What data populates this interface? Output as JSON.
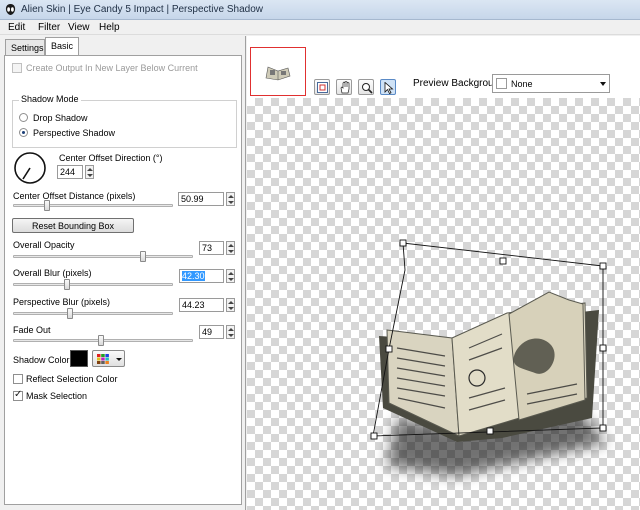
{
  "window": {
    "title": "Alien Skin | Eye Candy 5 Impact | Perspective Shadow"
  },
  "menu": {
    "items": [
      "Edit",
      "Filter",
      "View",
      "Help"
    ]
  },
  "tabs": [
    {
      "label": "Settings"
    },
    {
      "label": "Basic"
    }
  ],
  "basic": {
    "create_output_label": "Create Output In New Layer Below Current",
    "shadow_mode": {
      "title": "Shadow Mode",
      "options": [
        "Drop Shadow",
        "Perspective Shadow"
      ],
      "selected": "Perspective Shadow"
    },
    "center_offset_direction": {
      "label": "Center Offset Direction (°)",
      "value": "244"
    },
    "center_offset_distance": {
      "label": "Center Offset Distance (pixels)",
      "value": "50.99",
      "fraction": 0.2
    },
    "reset_button": "Reset Bounding Box",
    "overall_opacity": {
      "label": "Overall Opacity",
      "value": "73",
      "fraction": 0.73
    },
    "overall_blur": {
      "label": "Overall Blur (pixels)",
      "value": "42.30",
      "fraction": 0.33
    },
    "perspective_blur": {
      "label": "Perspective Blur (pixels)",
      "value": "44.23",
      "fraction": 0.35
    },
    "fade_out": {
      "label": "Fade Out",
      "value": "49",
      "fraction": 0.49
    },
    "shadow_color": {
      "label": "Shadow Color",
      "color": "#000000"
    },
    "reflect_selection": {
      "label": "Reflect Selection Color",
      "checked": false
    },
    "mask_selection": {
      "label": "Mask Selection",
      "checked": true
    }
  },
  "preview": {
    "background_label": "Preview Background:",
    "background_value": "None",
    "tools": [
      "navigator-icon",
      "hand-icon",
      "zoom-icon",
      "arrow-icon"
    ],
    "accent_border": "#e03030"
  }
}
